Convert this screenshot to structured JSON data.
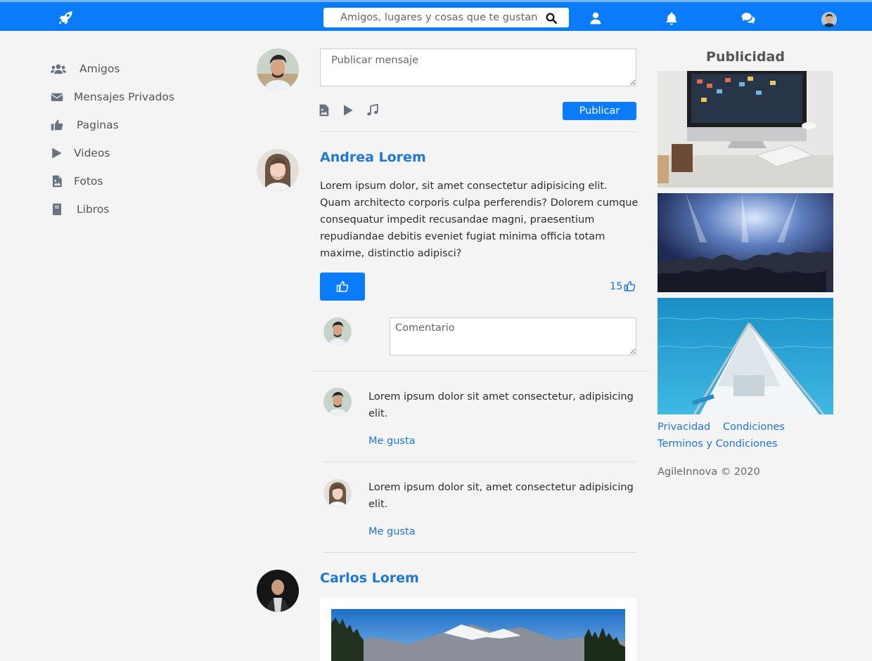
{
  "header": {
    "search_placeholder": "Amigos, lugares y cosas que te gustan",
    "brand_color": "#0a7bf9"
  },
  "sidebar": {
    "items": [
      {
        "label": "Amigos",
        "icon": "users-icon"
      },
      {
        "label": "Mensajes Privados",
        "icon": "envelope-icon"
      },
      {
        "label": "Paginas",
        "icon": "thumbs-up-icon"
      },
      {
        "label": "Videos",
        "icon": "play-icon"
      },
      {
        "label": "Fotos",
        "icon": "image-file-icon"
      },
      {
        "label": "Libros",
        "icon": "book-icon"
      }
    ]
  },
  "composer": {
    "placeholder": "Publicar mensaje",
    "publish_label": "Publicar"
  },
  "posts": [
    {
      "author": "Andrea Lorem",
      "text": "Lorem ipsum dolor, sit amet consectetur adipisicing elit. Quam architecto corporis culpa perferendis? Dolorem cumque consequatur impedit recusandae magni, praesentium repudiandae debitis eveniet fugiat minima officia totam maxime, distinctio adipisci?",
      "likes": "15",
      "comment_placeholder": "Comentario",
      "comments": [
        {
          "text": "Lorem ipsum dolor sit amet consectetur, adipisicing elit.",
          "like_label": "Me gusta"
        },
        {
          "text": "Lorem ipsum dolor sit, amet consectetur adipisicing elit.",
          "like_label": "Me gusta"
        }
      ]
    },
    {
      "author": "Carlos Lorem"
    }
  ],
  "ads": {
    "title": "Publicidad",
    "links": {
      "privacy": "Privacidad",
      "conditions": "Condiciones",
      "terms": "Terminos y Condiciones"
    },
    "copyright": "AgileInnova © 2020"
  }
}
